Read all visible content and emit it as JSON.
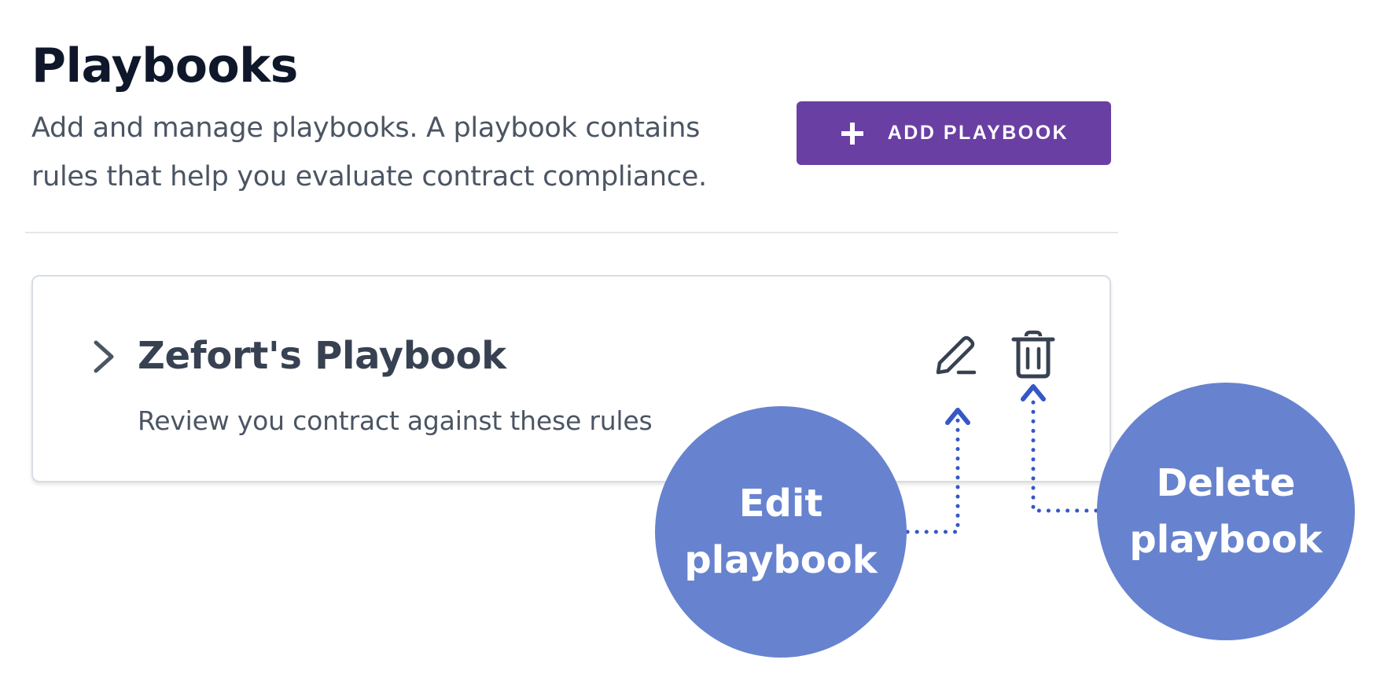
{
  "header": {
    "title": "Playbooks",
    "description": "Add and manage playbooks. A playbook contains rules that help you evaluate contract compliance.",
    "add_button_label": "ADD PLAYBOOK"
  },
  "playbooks": [
    {
      "name": "Zefort's Playbook",
      "description": "Review you contract against these rules"
    }
  ],
  "callouts": {
    "edit": "Edit playbook",
    "delete": "Delete playbook"
  },
  "colors": {
    "primary_button": "#6a3fa3",
    "callout_bubble": "#6783cf",
    "callout_dots": "#3557c7",
    "title_text": "#0f172a",
    "body_text": "#4b5563"
  },
  "icons": {
    "add": "plus-icon",
    "expand": "chevron-right-icon",
    "edit": "pencil-icon",
    "delete": "trash-icon"
  }
}
